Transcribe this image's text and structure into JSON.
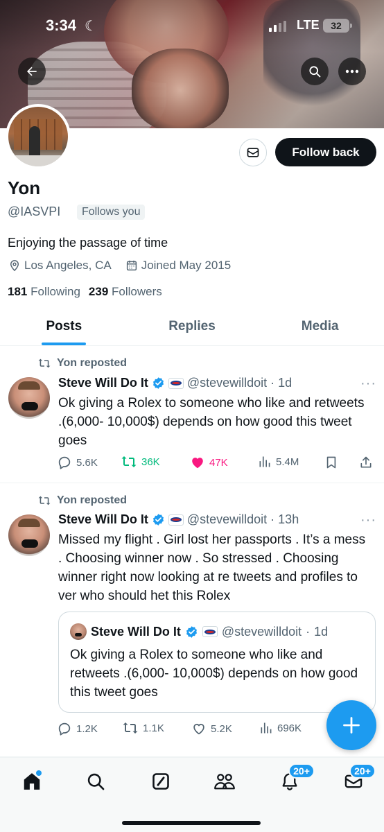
{
  "status_bar": {
    "time": "3:34",
    "network": "LTE",
    "battery": "32"
  },
  "profile": {
    "name": "Yon",
    "handle": "@IASVPI",
    "follows_you": "Follows you",
    "bio": "Enjoying the passage of time",
    "location": "Los Angeles, CA",
    "joined": "Joined May 2015",
    "following_count": "181",
    "following_label": "Following",
    "followers_count": "239",
    "followers_label": "Followers",
    "follow_button": "Follow back"
  },
  "tabs": [
    {
      "label": "Posts",
      "active": true
    },
    {
      "label": "Replies",
      "active": false
    },
    {
      "label": "Media",
      "active": false
    }
  ],
  "tweets": [
    {
      "repost_label": "Yon reposted",
      "author": "Steve Will Do It",
      "handle": "@stevewilldoit",
      "sep": "·",
      "time": "1d",
      "text": "Ok giving a Rolex to someone who like and retweets .(6,000- 10,000$) depends on how good this tweet goes",
      "replies": "5.6K",
      "reposts": "36K",
      "likes": "47K",
      "views": "5.4M"
    },
    {
      "repost_label": "Yon reposted",
      "author": "Steve Will Do It",
      "handle": "@stevewilldoit",
      "sep": "·",
      "time": "13h",
      "text": "Missed my flight . Girl lost her passports . It’s a mess . Choosing winner now . So stressed . Choosing winner right now looking at re tweets and profiles to ver who should het this Rolex",
      "quote": {
        "author": "Steve Will Do It",
        "handle": "@stevewilldoit",
        "sep": "·",
        "time": "1d",
        "text": "Ok giving a Rolex to someone who like and retweets .(6,000- 10,000$) depends on how good this tweet goes"
      },
      "replies": "1.2K",
      "reposts": "1.1K",
      "likes": "5.2K",
      "views": "696K"
    }
  ],
  "bottom_nav": {
    "notifications_badge": "20+",
    "messages_badge": "20+"
  },
  "colors": {
    "accent": "#1d9bf0",
    "repost_active": "#00ba7c",
    "like_active": "#f91880",
    "text_primary": "#0f1419",
    "text_secondary": "#536471"
  },
  "icons": [
    "back-arrow-icon",
    "search-icon",
    "more-icon",
    "mail-icon",
    "location-icon",
    "calendar-icon",
    "repost-icon",
    "verified-icon",
    "reply-icon",
    "like-icon",
    "views-icon",
    "bookmark-icon",
    "share-icon",
    "compose-icon",
    "home-icon",
    "grok-icon",
    "communities-icon",
    "bell-icon",
    "messages-icon"
  ]
}
